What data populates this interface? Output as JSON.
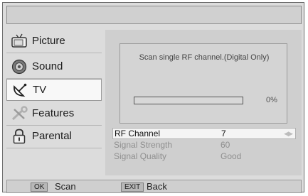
{
  "menu": {
    "items": [
      {
        "label": "Picture",
        "icon": "tv-icon"
      },
      {
        "label": "Sound",
        "icon": "speaker-icon"
      },
      {
        "label": "TV",
        "icon": "satellite-icon"
      },
      {
        "label": "Features",
        "icon": "tools-icon"
      },
      {
        "label": "Parental",
        "icon": "lock-icon"
      }
    ],
    "selected": "TV"
  },
  "scan": {
    "message": "Scan single RF channel.(Digital Only)",
    "progress_percent": 0,
    "progress_text": "0%"
  },
  "settings": [
    {
      "label": "RF Channel",
      "value": "7"
    },
    {
      "label": "Signal Strength",
      "value": "60"
    },
    {
      "label": "Signal Quality",
      "value": "Good"
    }
  ],
  "footer": {
    "ok_key": "OK",
    "ok_label": "Scan",
    "exit_key": "EXIT",
    "exit_label": "Back"
  }
}
